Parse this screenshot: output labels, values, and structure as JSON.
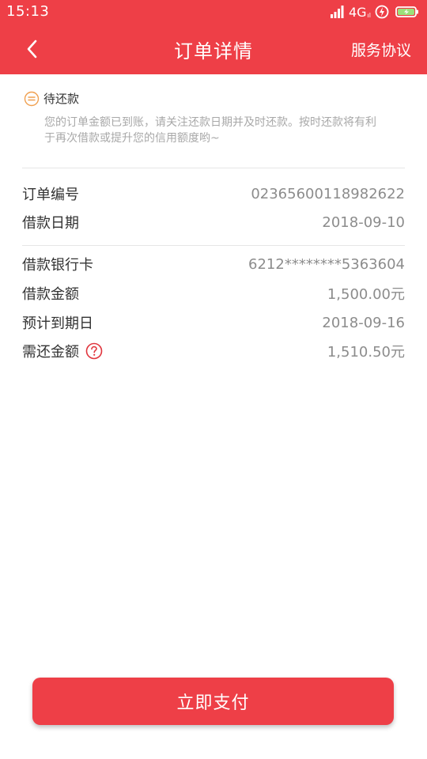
{
  "status_bar": {
    "time": "15:13",
    "network": "4G",
    "network_sub": "ıl"
  },
  "nav": {
    "title": "订单详情",
    "right_link": "服务协议",
    "back_icon": "chevron-left-icon"
  },
  "order_status": {
    "label": "待还款",
    "description": "您的订单金额已到账，请关注还款日期并及时还款。按时还款将有利于再次借款或提升您的信用额度哟~",
    "icon": "pending-icon"
  },
  "order_info": [
    {
      "label": "订单编号",
      "value": "02365600118982622"
    },
    {
      "label": "借款日期",
      "value": "2018-09-10"
    }
  ],
  "loan_info": [
    {
      "label": "借款银行卡",
      "value": "6212********5363604"
    },
    {
      "label": "借款金额",
      "value": "1,500.00元"
    },
    {
      "label": "预计到期日",
      "value": "2018-09-16"
    },
    {
      "label": "需还金额",
      "value": "1,510.50元"
    }
  ],
  "actions": {
    "pay_button": "立即支付"
  },
  "colors": {
    "brand_red": "#ee3f47",
    "status_orange": "#f0a050",
    "text_dark": "#333333",
    "text_muted": "#8c8c8c"
  }
}
